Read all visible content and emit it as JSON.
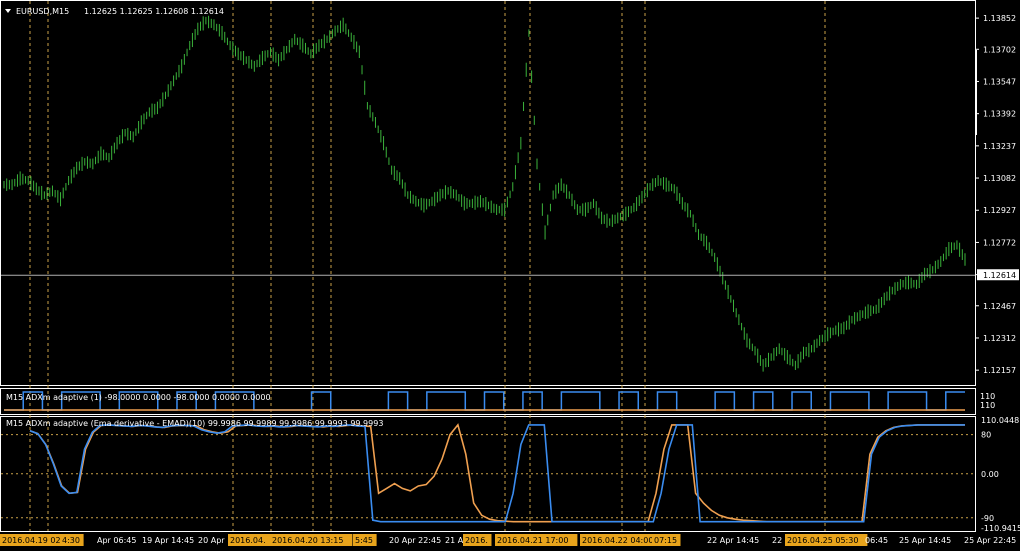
{
  "main_header": {
    "symbol_timeframe": "EURUSD,M15",
    "ohlc": "1.12625 1.12625 1.12608 1.12614"
  },
  "ind1_header": "M15 ADXm adaptive (1) -98.0000 0.0000 -98.0000 0.0000 0.0000",
  "ind2_header": "M15 ADXm adaptive (Ema derivative - EMAD)(10) 99.9986 99.9989 99.9986 99.9993 99.9993",
  "colors": {
    "bar": "#3bb33b",
    "grid": "#c8a048",
    "bid_line": "#b0b0b0",
    "up_line": "#3a8cf0",
    "down_line": "#f0a050",
    "ind_ref": "#c8a048",
    "highlight": "#e8a41c"
  },
  "chart_data": [
    {
      "type": "candlestick",
      "title": "EURUSD,M15",
      "y_ticks": [
        "1.13852",
        "1.13702",
        "1.13547",
        "1.13392",
        "1.13237",
        "1.13082",
        "1.12927",
        "1.12772",
        "1.12617",
        "1.12467",
        "1.12312",
        "1.12157"
      ],
      "ylim": [
        1.121,
        1.1392
      ],
      "current_price": "1.12614",
      "close_series": [
        1.1305,
        1.1308,
        1.1307,
        1.1303,
        1.13,
        1.1302,
        1.1298,
        1.1307,
        1.1313,
        1.1316,
        1.1315,
        1.132,
        1.1318,
        1.1325,
        1.133,
        1.1328,
        1.1335,
        1.134,
        1.1342,
        1.1348,
        1.1355,
        1.1362,
        1.1372,
        1.138,
        1.1384,
        1.1382,
        1.1378,
        1.1372,
        1.1368,
        1.1365,
        1.1362,
        1.1366,
        1.1369,
        1.1365,
        1.137,
        1.1375,
        1.1372,
        1.1368,
        1.1372,
        1.1375,
        1.1379,
        1.1382,
        1.1376,
        1.1369,
        1.1343,
        1.1335,
        1.1325,
        1.1312,
        1.1308,
        1.13,
        1.1297,
        1.1295,
        1.1297,
        1.13,
        1.1302,
        1.13,
        1.1296,
        1.1296,
        1.1297,
        1.1295,
        1.1293,
        1.1293,
        1.1304,
        1.1325,
        1.1378,
        1.1315,
        1.1282,
        1.13,
        1.1305,
        1.13,
        1.1293,
        1.1293,
        1.1296,
        1.1289,
        1.1287,
        1.1289,
        1.1291,
        1.1294,
        1.1299,
        1.1304,
        1.1307,
        1.1305,
        1.1303,
        1.1296,
        1.1291,
        1.1281,
        1.1277,
        1.127,
        1.126,
        1.125,
        1.124,
        1.123,
        1.1225,
        1.1218,
        1.1222,
        1.1226,
        1.1222,
        1.1218,
        1.1224,
        1.1226,
        1.123,
        1.1233,
        1.1235,
        1.1236,
        1.124,
        1.1242,
        1.1244,
        1.1245,
        1.125,
        1.1254,
        1.1257,
        1.1258,
        1.1257,
        1.1262,
        1.1264,
        1.1268,
        1.1274,
        1.1276,
        1.1269,
        1.1261
      ],
      "grid_vlines_x_labels": [
        "2016.04.19 02:00",
        "19 Apr 14:45",
        "2016.04.20 13:15",
        "20 Apr 22:45",
        "2016.04.21 17:00",
        "2016.04.22 04:00",
        "22 Apr 14:45",
        "2016.04.25 05:30",
        "25 Apr 14:45"
      ]
    },
    {
      "type": "line",
      "title": "M15 ADXm adaptive (1)",
      "y_ticks": [
        "110",
        "110"
      ],
      "series": [
        {
          "values_low_high": [
            0,
            1,
            0,
            1,
            1,
            0,
            1,
            1,
            0,
            1,
            0,
            1,
            1,
            0,
            0,
            0,
            1,
            0,
            0,
            0,
            1,
            0,
            1,
            1,
            0,
            1,
            0,
            1,
            0,
            1,
            1,
            0,
            1,
            0,
            1,
            0,
            0,
            1,
            0,
            1,
            0,
            1,
            0,
            1,
            1,
            0,
            1,
            1,
            0,
            1
          ]
        }
      ]
    },
    {
      "type": "line",
      "title": "M15 ADXm adaptive (Ema derivative - EMAD)(10)",
      "y_ticks": [
        "110.0448",
        "80",
        "0.00",
        "-90",
        "-110.9415"
      ],
      "ylim": [
        -110.9415,
        110.0448
      ],
      "levels": [
        80,
        0,
        -90
      ],
      "series": [
        {
          "name": "up",
          "values": [
            88,
            82,
            60,
            20,
            -25,
            -40,
            -38,
            50,
            85,
            99,
            100,
            99,
            98,
            97,
            99,
            98,
            96,
            95,
            98,
            99,
            99,
            98,
            90,
            86,
            83,
            86,
            98,
            99,
            100,
            98,
            97,
            98,
            96,
            97,
            99,
            98,
            97,
            96,
            98,
            97,
            99,
            100,
            98,
            97,
            -95,
            -98,
            -98,
            -98,
            -98,
            -98,
            -98,
            -98,
            -98,
            -98,
            -98,
            -98,
            -98,
            -98,
            -98,
            -98,
            -98,
            -98,
            -40,
            60,
            100,
            100,
            100,
            -98,
            -98,
            -98,
            -98,
            -98,
            -98,
            -98,
            -98,
            -98,
            -98,
            -98,
            -98,
            -98,
            -98,
            -40,
            50,
            100,
            100,
            100,
            -98,
            -98,
            -98,
            -98,
            -98,
            -98,
            -98,
            -98,
            -98,
            -98,
            -98,
            -98,
            -98,
            -98,
            -98,
            -98,
            -98,
            -98,
            -98,
            -98,
            -98,
            -98,
            40,
            75,
            88,
            95,
            98,
            99,
            100,
            100,
            100,
            100,
            100,
            100,
            100
          ]
        },
        {
          "name": "down",
          "values": [
            88,
            82,
            60,
            20,
            -25,
            -40,
            -38,
            50,
            85,
            99,
            100,
            99,
            98,
            97,
            99,
            98,
            96,
            95,
            98,
            99,
            99,
            98,
            90,
            86,
            83,
            86,
            98,
            99,
            100,
            98,
            97,
            98,
            96,
            97,
            99,
            98,
            97,
            96,
            98,
            97,
            99,
            100,
            98,
            97,
            -40,
            -30,
            -20,
            -30,
            -35,
            -25,
            -22,
            -5,
            30,
            80,
            100,
            40,
            -60,
            -85,
            -93,
            -96,
            -97,
            -98,
            -98,
            -98,
            -98,
            -98,
            -98,
            -98,
            -98,
            -98,
            -98,
            -98,
            -98,
            -98,
            -98,
            -98,
            -98,
            -98,
            -98,
            -40,
            50,
            100,
            100,
            100,
            -40,
            -60,
            -75,
            -85,
            -90,
            -93,
            -95,
            -96,
            -97,
            -98,
            -98,
            -98,
            -98,
            -98,
            -98,
            -98,
            -98,
            -98,
            -98,
            -98,
            -98,
            -98,
            40,
            75,
            88,
            95,
            98,
            99,
            100,
            100,
            100,
            100,
            100,
            100,
            100
          ]
        }
      ]
    }
  ],
  "x_axis": {
    "labels": [
      {
        "text": "2016.04.19 02:00",
        "highlight": true
      },
      {
        "text": "4:30",
        "highlight": true
      },
      {
        "text": "Apr 06:45",
        "highlight": false
      },
      {
        "text": "19 Apr 14:45",
        "highlight": false
      },
      {
        "text": "20 Apr",
        "highlight": false
      },
      {
        "text": "2016.04.",
        "highlight": true
      },
      {
        "text": "2016.04.20 13:15",
        "highlight": true
      },
      {
        "text": "5:45",
        "highlight": true
      },
      {
        "text": "20 Apr 22:45",
        "highlight": false
      },
      {
        "text": "21 Apr",
        "highlight": false
      },
      {
        "text": "2016.",
        "highlight": true
      },
      {
        "text": "2016.04.21 17:00",
        "highlight": true
      },
      {
        "text": "2016.04.22 04:00",
        "highlight": true
      },
      {
        "text": "07:15",
        "highlight": true
      },
      {
        "text": "22 Apr 14:45",
        "highlight": false
      },
      {
        "text": "22",
        "highlight": false
      },
      {
        "text": "2016.04.25 05:30",
        "highlight": true
      },
      {
        "text": "06:45",
        "highlight": false
      },
      {
        "text": "25 Apr 14:45",
        "highlight": false
      },
      {
        "text": "25 Apr 22:45",
        "highlight": false
      }
    ]
  }
}
